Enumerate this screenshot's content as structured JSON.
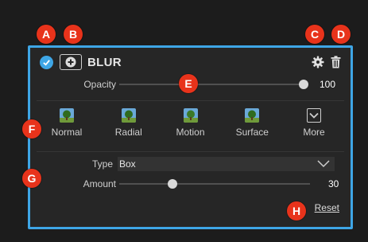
{
  "callouts": {
    "a": "A",
    "b": "B",
    "c": "C",
    "d": "D",
    "e": "E",
    "f": "F",
    "g": "G",
    "h": "H"
  },
  "header": {
    "title": "BLUR",
    "enabled": true,
    "icons": [
      "checkmark-icon",
      "plus-icon",
      "gear-icon",
      "trash-icon"
    ]
  },
  "opacity": {
    "label": "Opacity",
    "value": "100",
    "level": 1.0
  },
  "types": [
    {
      "name": "Normal",
      "icon": "tree-thumbnail"
    },
    {
      "name": "Radial",
      "icon": "tree-thumbnail"
    },
    {
      "name": "Motion",
      "icon": "tree-thumbnail"
    },
    {
      "name": "Surface",
      "icon": "tree-thumbnail"
    },
    {
      "name": "More",
      "icon": "chevron-down-icon"
    }
  ],
  "type_select": {
    "label": "Type",
    "selected": "Box"
  },
  "amount": {
    "label": "Amount",
    "value": "30",
    "level": 0.28
  },
  "reset": {
    "label": "Reset"
  },
  "colors": {
    "accent": "#3ea6e6",
    "callout": "#e8331b",
    "panel": "#262626",
    "background": "#1c1c1c"
  }
}
